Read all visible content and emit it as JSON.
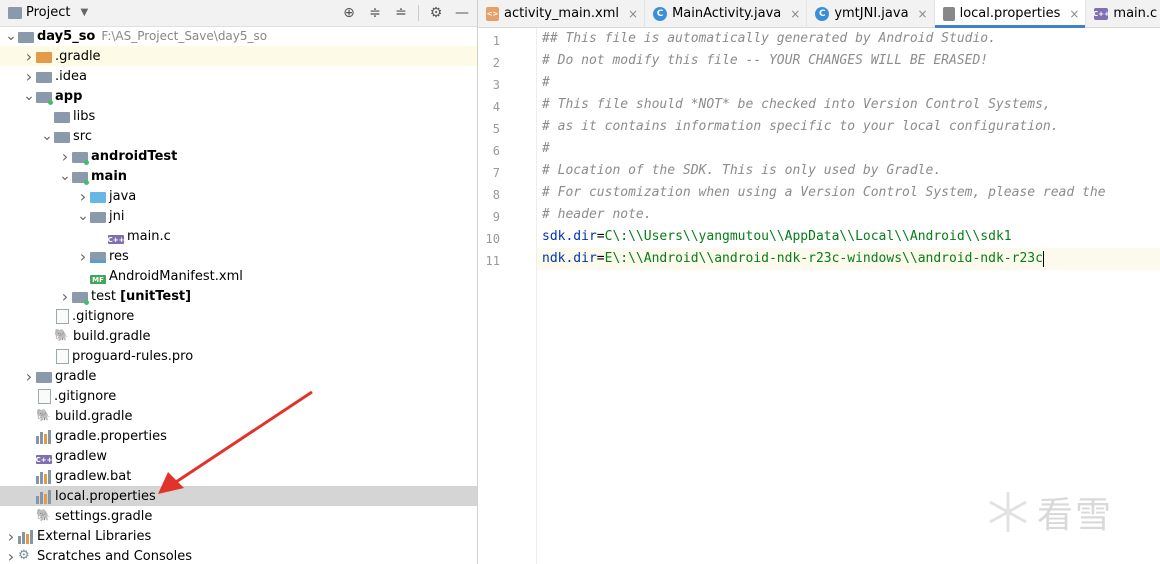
{
  "project_panel": {
    "title": "Project",
    "tools": [
      "target-icon",
      "expand-all-icon",
      "collapse-all-icon",
      "gear-icon",
      "minimize-icon"
    ]
  },
  "tree": [
    {
      "label": "day5_so",
      "path": "F:\\AS_Project_Save\\day5_so",
      "indent": 0,
      "arrow": "down",
      "icon": "folder",
      "bold": true
    },
    {
      "label": ".gradle",
      "indent": 1,
      "arrow": "right",
      "icon": "folder-orange",
      "hl": true
    },
    {
      "label": ".idea",
      "indent": 1,
      "arrow": "right",
      "icon": "folder"
    },
    {
      "label": "app",
      "indent": 1,
      "arrow": "down",
      "icon": "folder-module",
      "bold": true
    },
    {
      "label": "libs",
      "indent": 2,
      "arrow": "",
      "icon": "folder"
    },
    {
      "label": "src",
      "indent": 2,
      "arrow": "down",
      "icon": "folder"
    },
    {
      "label": "androidTest",
      "indent": 3,
      "arrow": "right",
      "icon": "folder-module",
      "bold": true
    },
    {
      "label": "main",
      "indent": 3,
      "arrow": "down",
      "icon": "folder-module",
      "bold": true
    },
    {
      "label": "java",
      "indent": 4,
      "arrow": "right",
      "icon": "folder-blue"
    },
    {
      "label": "jni",
      "indent": 4,
      "arrow": "down",
      "icon": "folder"
    },
    {
      "label": "main.c",
      "indent": 5,
      "arrow": "",
      "icon": "cfile"
    },
    {
      "label": "res",
      "indent": 4,
      "arrow": "right",
      "icon": "folder-res"
    },
    {
      "label": "AndroidManifest.xml",
      "indent": 4,
      "arrow": "",
      "icon": "manifest"
    },
    {
      "label": "test [unitTest]",
      "indent": 3,
      "arrow": "right",
      "icon": "folder-module",
      "boldpart": "[unitTest]"
    },
    {
      "label": ".gitignore",
      "indent": 2,
      "arrow": "",
      "icon": "file"
    },
    {
      "label": "build.gradle",
      "indent": 2,
      "arrow": "",
      "icon": "gradle"
    },
    {
      "label": "proguard-rules.pro",
      "indent": 2,
      "arrow": "",
      "icon": "file"
    },
    {
      "label": "gradle",
      "indent": 1,
      "arrow": "right",
      "icon": "folder"
    },
    {
      "label": ".gitignore",
      "indent": 1,
      "arrow": "",
      "icon": "file"
    },
    {
      "label": "build.gradle",
      "indent": 1,
      "arrow": "",
      "icon": "gradle"
    },
    {
      "label": "gradle.properties",
      "indent": 1,
      "arrow": "",
      "icon": "bars"
    },
    {
      "label": "gradlew",
      "indent": 1,
      "arrow": "",
      "icon": "cfile"
    },
    {
      "label": "gradlew.bat",
      "indent": 1,
      "arrow": "",
      "icon": "bars"
    },
    {
      "label": "local.properties",
      "indent": 1,
      "arrow": "",
      "icon": "bars",
      "sel": true
    },
    {
      "label": "settings.gradle",
      "indent": 1,
      "arrow": "",
      "icon": "gradle"
    },
    {
      "label": "External Libraries",
      "indent": 0,
      "arrow": "right",
      "icon": "bars"
    },
    {
      "label": "Scratches and Consoles",
      "indent": 0,
      "arrow": "right",
      "icon": "scratch"
    }
  ],
  "tabs": [
    {
      "label": "activity_main.xml",
      "icon": "xml",
      "active": false
    },
    {
      "label": "MainActivity.java",
      "icon": "c",
      "active": false
    },
    {
      "label": "ymtJNI.java",
      "icon": "c",
      "active": false
    },
    {
      "label": "local.properties",
      "icon": "prop",
      "active": true
    },
    {
      "label": "main.c",
      "icon": "cpp",
      "active": false
    }
  ],
  "code_lines": [
    {
      "n": "1",
      "type": "comment",
      "text": "## This file is automatically generated by Android Studio."
    },
    {
      "n": "2",
      "type": "comment",
      "text": "# Do not modify this file -- YOUR CHANGES WILL BE ERASED!"
    },
    {
      "n": "3",
      "type": "comment",
      "text": "#"
    },
    {
      "n": "4",
      "type": "comment",
      "text": "# This file should *NOT* be checked into Version Control Systems,"
    },
    {
      "n": "5",
      "type": "comment",
      "text": "# as it contains information specific to your local configuration."
    },
    {
      "n": "6",
      "type": "comment",
      "text": "#"
    },
    {
      "n": "7",
      "type": "comment",
      "text": "# Location of the SDK. This is only used by Gradle."
    },
    {
      "n": "8",
      "type": "comment",
      "text": "# For customization when using a Version Control System, please read the"
    },
    {
      "n": "9",
      "type": "comment",
      "text": "# header note."
    },
    {
      "n": "10",
      "type": "prop",
      "key": "sdk.dir",
      "val": "C\\:\\\\Users\\\\yangmutou\\\\AppData\\\\Local\\\\Android\\\\sdk1"
    },
    {
      "n": "11",
      "type": "prop",
      "key": "ndk.dir",
      "val": "E\\:\\\\Android\\\\android-ndk-r23c-windows\\\\android-ndk-r23c",
      "current": true
    }
  ],
  "watermark": "看雪"
}
